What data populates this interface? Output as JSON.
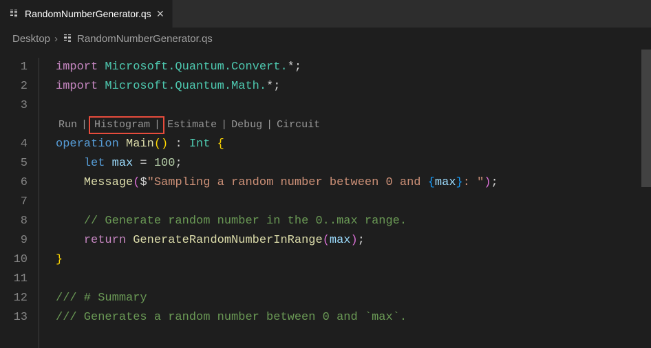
{
  "tab": {
    "filename": "RandomNumberGenerator.qs"
  },
  "breadcrumbs": {
    "parent": "Desktop",
    "file": "RandomNumberGenerator.qs"
  },
  "gutter": {
    "lines": [
      "1",
      "2",
      "3",
      "",
      "4",
      "5",
      "6",
      "7",
      "8",
      "9",
      "10",
      "11",
      "12",
      "13"
    ]
  },
  "codelens": {
    "run": "Run",
    "histogram": "Histogram",
    "estimate": "Estimate",
    "debug": "Debug",
    "circuit": "Circuit",
    "sep": "|"
  },
  "code": {
    "l1": {
      "kw": "import",
      "ns": " Microsoft.Quantum.Convert.",
      "star": "*",
      "semi": ";"
    },
    "l2": {
      "kw": "import",
      "ns": " Microsoft.Quantum.Math.",
      "star": "*",
      "semi": ";"
    },
    "l4": {
      "op": "operation",
      "fn": " Main",
      "p1": "(",
      "p2": ")",
      "colon": " : ",
      "ty": "Int",
      "br": " {"
    },
    "l5": {
      "ind": "    ",
      "let": "let",
      "var": " max",
      "eq": " = ",
      "num": "100",
      "semi": ";"
    },
    "l6": {
      "ind": "    ",
      "fn": "Message",
      "p1": "(",
      "dollar": "$",
      "q": "\"",
      "str1": "Sampling a random number between 0 and ",
      "lb": "{",
      "var": "max",
      "rb": "}",
      "str2": ": ",
      "q2": "\"",
      "p2": ")",
      "semi": ";"
    },
    "l8": {
      "ind": "    ",
      "cm": "// Generate random number in the 0..max range."
    },
    "l9": {
      "ind": "    ",
      "ret": "return",
      "fn": " GenerateRandomNumberInRange",
      "p1": "(",
      "var": "max",
      "p2": ")",
      "semi": ";"
    },
    "l10": {
      "cb": "}"
    },
    "l12": {
      "cm": "/// # Summary"
    },
    "l13": {
      "cm": "/// Generates a random number between 0 and `max`."
    }
  }
}
